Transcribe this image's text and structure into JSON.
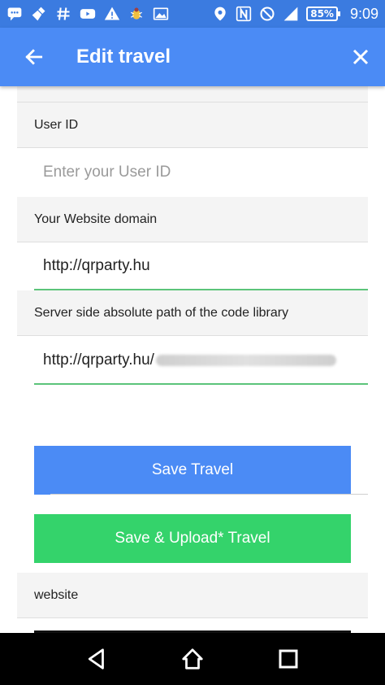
{
  "status_bar": {
    "battery": "85%",
    "time": "9:09",
    "icons": [
      "chat-icon",
      "broom-icon",
      "hashtag-icon",
      "youtube-icon",
      "warning-icon",
      "bug-icon",
      "image-icon",
      "location-icon",
      "nfc-icon",
      "block-icon",
      "signal-icon"
    ]
  },
  "app_bar": {
    "title": "Edit travel"
  },
  "form": {
    "user_id": {
      "label": "User ID",
      "placeholder": "Enter your User ID"
    },
    "website_domain": {
      "label": "Your Website domain",
      "value": "http://qrparty.hu"
    },
    "server_path": {
      "label": "Server side absolute path of the code library",
      "value": "http://qrparty.hu/"
    },
    "save_button": "Save Travel",
    "upload_button": "Save & Upload* Travel",
    "website_section_label": "website"
  },
  "colors": {
    "status_bar": "#3b7be0",
    "app_bar": "#4b8bf5",
    "save_button": "#4b8bf5",
    "upload_button": "#34d36b",
    "input_underline": "#5cc47a"
  },
  "nav_bar": {
    "icons": [
      "back-triangle-icon",
      "home-icon",
      "recents-icon"
    ]
  }
}
